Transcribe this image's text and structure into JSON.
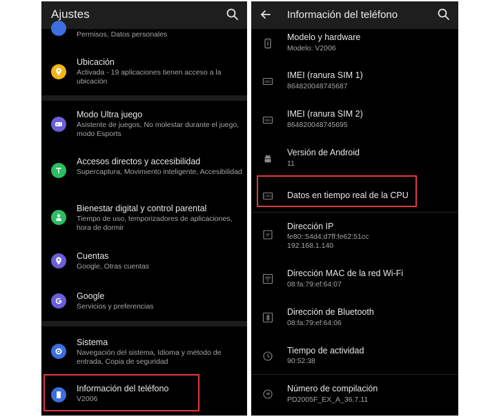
{
  "left": {
    "title": "Ajustes",
    "items": [
      {
        "subtitle": "Permisos, Datos personales"
      },
      {
        "title": "Ubicación",
        "subtitle": "Activada - 19 aplicaciones tienen acceso a la ubicación"
      },
      {
        "title": "Modo Ultra juego",
        "subtitle": "Asistente de juegos, No molestar durante el juego, modo Esports"
      },
      {
        "title": "Accesos directos y accesibilidad",
        "subtitle": "Supercaptura, Movimiento inteligente, Accesibilidad"
      },
      {
        "title": "Bienestar digital y control parental",
        "subtitle": "Tiempo de uso, temporizadores de aplicaciones, hora de dormir"
      },
      {
        "title": "Cuentas",
        "subtitle": "Google, Otras cuentas"
      },
      {
        "title": "Google",
        "subtitle": "Servicios y preferencias"
      },
      {
        "title": "Sistema",
        "subtitle": "Navegación del sistema, Idioma y método de entrada, Copia de seguridad"
      },
      {
        "title": "Información del teléfono",
        "subtitle": "V2006"
      }
    ]
  },
  "right": {
    "title": "Información del teléfono",
    "items": [
      {
        "title": "Modelo y hardware",
        "subtitle": "Modelo: V2006"
      },
      {
        "title": "IMEI (ranura SIM 1)",
        "subtitle": "864820048745687"
      },
      {
        "title": "IMEI (ranura SIM 2)",
        "subtitle": "864820048745695"
      },
      {
        "title": "Versión de Android",
        "subtitle": "11"
      },
      {
        "title": "Datos en tiempo real de la CPU"
      },
      {
        "title": "Dirección IP",
        "subtitle": "fe80::54d4:d7ff:fe62:51cc",
        "subtitle2": "192.168.1.140"
      },
      {
        "title": "Dirección MAC de la red Wi-Fi",
        "subtitle": "08:fa:79:ef:64:07"
      },
      {
        "title": "Dirección de Bluetooth",
        "subtitle": "08:fa:79:ef:64:06"
      },
      {
        "title": "Tiempo de actividad",
        "subtitle": "90:52:38"
      },
      {
        "title": "Número de compilación",
        "subtitle": "PD2005F_EX_A_36.7.11"
      }
    ]
  },
  "colors": {
    "highlight": "#e03a3a",
    "ubicacion": "#f2b517",
    "ultra_juego": "#6a5fd6",
    "accesos": "#2dbd63",
    "bienestar": "#2dbd63",
    "cuentas": "#6a5fd6",
    "google": "#6a5fd6",
    "sistema": "#3b6fe0",
    "info": "#3b6fe0"
  },
  "icons": {
    "left": [
      "privacy-icon",
      "location-icon",
      "game-icon",
      "accessibility-icon",
      "wellbeing-icon",
      "account-icon",
      "google-icon",
      "system-icon",
      "phone-info-icon"
    ],
    "right": [
      "info-icon",
      "imei-icon",
      "imei-icon",
      "android-icon",
      "cpu-icon",
      "ip-icon",
      "wifi-icon",
      "bluetooth-icon",
      "clock-icon",
      "build-icon"
    ]
  }
}
